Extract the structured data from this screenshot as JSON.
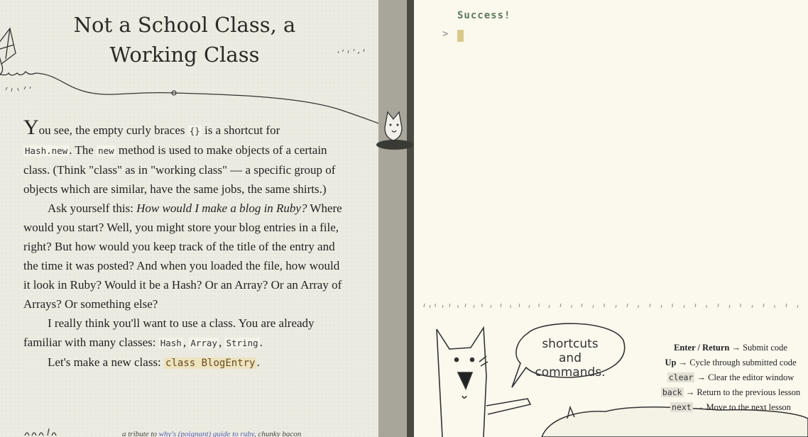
{
  "lesson": {
    "title": "Not a School Class, a Working Class",
    "p1": {
      "dropcap": "Y",
      "t1": "ou see, the empty curly braces ",
      "c1": "{}",
      "t2": " is a shortcut for ",
      "c2": "Hash.new",
      "t3": ". The ",
      "c3": "new",
      "t4": " method is used to make objects of a certain class. (Think \"class\" as in \"working class\" — a specific group of objects which are similar, have the same jobs, the same shirts.)"
    },
    "p2": {
      "t1": "Ask yourself this: ",
      "em": "How would I make a blog in Ruby?",
      "t2": " Where would you start? Well, you might store your blog entries in a file, right? But how would you keep track of the title of the entry and the time it was posted? And when you loaded the file, how would it look in Ruby? Would it be a Hash? Or an Array? Or an Array of Arrays? Or something else?"
    },
    "p3": {
      "t1": "I really think you'll want to use a class. You are already familiar with many classes: ",
      "c1": "Hash",
      "s1": ", ",
      "c2": "Array",
      "s2": ", ",
      "c3": "String",
      "t2": "."
    },
    "p4": {
      "t1": "Let's make a new class: ",
      "c1": "class BlogEntry",
      "t2": "."
    },
    "footer": {
      "tribute_prefix": "a tribute to ",
      "tribute_link": "why's (poignant) guide to ruby",
      "tribute_suffix": ", chunky bacon"
    }
  },
  "console": {
    "output": "Success!",
    "prompt": ">"
  },
  "cartoon": {
    "bubble_line1": "shortcuts",
    "bubble_line2": "and",
    "bubble_line3": "commands."
  },
  "help": {
    "rows": [
      {
        "key": "Enter / Return",
        "desc": "Submit code"
      },
      {
        "key": "Up",
        "desc": "Cycle through submitted code"
      },
      {
        "key": "clear",
        "desc": "Clear the editor window"
      },
      {
        "key": "back",
        "desc": "Return to the previous lesson"
      },
      {
        "key": "next",
        "desc": "Move to the next lesson"
      }
    ],
    "arrow": "→"
  }
}
